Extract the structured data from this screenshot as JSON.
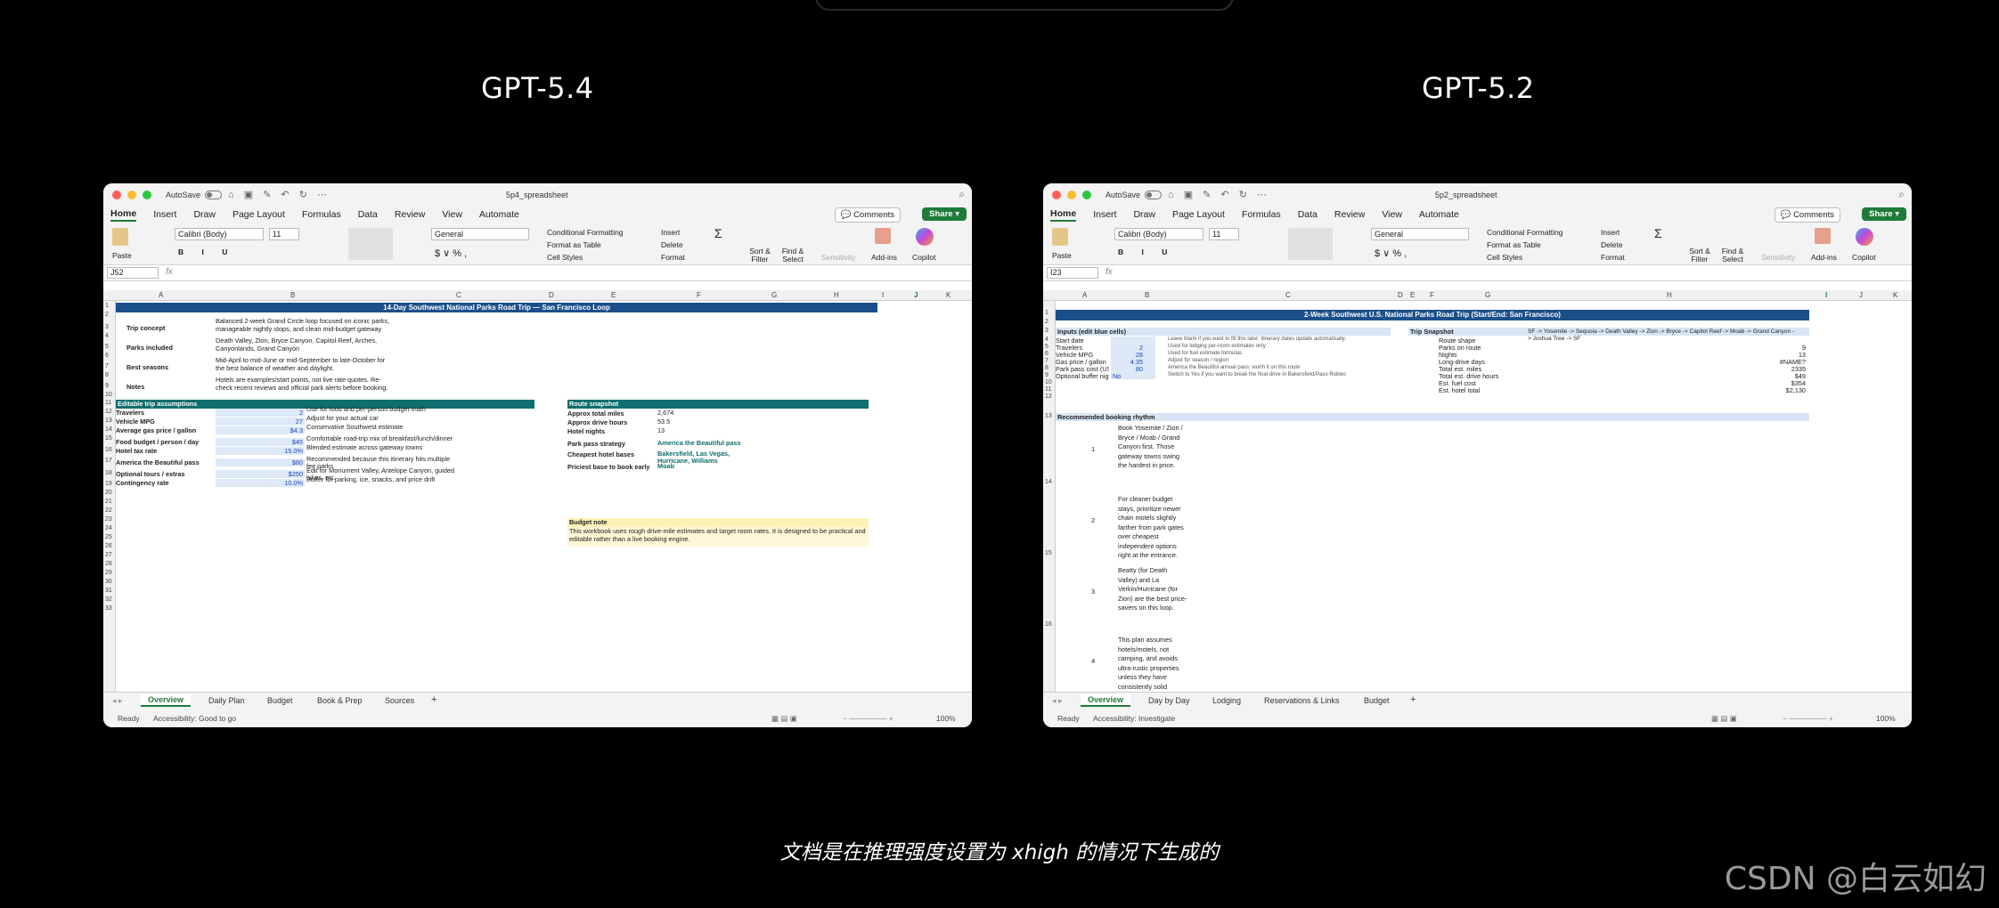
{
  "labels": {
    "left": "GPT-5.4",
    "right": "GPT-5.2",
    "caption": "文档是在推理强度设置为 xhigh 的情况下生成的",
    "watermark": "CSDN @白云如幻"
  },
  "common": {
    "autosave": "AutoSave",
    "menu": [
      "Home",
      "Insert",
      "Draw",
      "Page Layout",
      "Formulas",
      "Data",
      "Review",
      "View",
      "Automate"
    ],
    "comments": "Comments",
    "share": "Share",
    "font": "Calibri (Body)",
    "size": "11",
    "number_format": "General",
    "cond_fmt": "Conditional Formatting",
    "fmt_table": "Format as Table",
    "cell_styles": "Cell Styles",
    "insert": "Insert",
    "delete": "Delete",
    "format": "Format",
    "sort": "Sort & Filter",
    "find": "Find & Select",
    "sensitivity": "Sensitivity",
    "addins": "Add-ins",
    "copilot": "Copilot",
    "paste": "Paste",
    "fx": "fx",
    "ready": "Ready",
    "zoom": "100%"
  },
  "left": {
    "filename": "5p4_spreadsheet",
    "namebox": "J52",
    "title": "14-Day Southwest National Parks Road Trip — San Francisco Loop",
    "cols": [
      "A",
      "B",
      "C",
      "D",
      "E",
      "F",
      "G",
      "H",
      "I",
      "J",
      "K"
    ],
    "info": [
      {
        "k": "Trip concept",
        "v": "Balanced 2-week Grand Circle loop focused on iconic parks, manageable nightly stops, and clean mid-budget gateway"
      },
      {
        "k": "Parks included",
        "v": "Death Valley, Zion, Bryce Canyon, Capitol Reef, Arches, Canyonlands, Grand Canyon"
      },
      {
        "k": "Best seasons",
        "v": "Mid-April to mid-June or mid-September to late-October for the best balance of weather and daylight."
      },
      {
        "k": "Notes",
        "v": "Hotels are examples/start points, not live rate quotes. Re-check recent reviews and official park alerts before booking."
      }
    ],
    "assump_title": "Editable trip assumptions",
    "assump": [
      {
        "k": "Travelers",
        "v": "2",
        "n": "Use for food and per-person budget math"
      },
      {
        "k": "Vehicle MPG",
        "v": "27",
        "n": "Adjust for your actual car"
      },
      {
        "k": "Average gas price / gallon",
        "v": "$4.3",
        "n": "Conservative Southwest estimate"
      },
      {
        "k": "Food budget / person / day",
        "v": "$45",
        "n": "Comfortable road-trip mix of breakfast/lunch/dinner"
      },
      {
        "k": "Hotel tax rate",
        "v": "15.0%",
        "n": "Blended estimate across gateway towns"
      },
      {
        "k": "America the Beautiful pass",
        "v": "$80",
        "n": "Recommended because this itinerary hits multiple fee parks"
      },
      {
        "k": "Optional tours / extras",
        "v": "$250",
        "n": "Edit for Monument Valley, Antelope Canyon, guided hikes, etc."
      },
      {
        "k": "Contingency rate",
        "v": "10.0%",
        "n": "Buffer for parking, ice, snacks, and price drift"
      }
    ],
    "snap_title": "Route snapshot",
    "snap": [
      {
        "k": "Approx total miles",
        "v": "2,674"
      },
      {
        "k": "Approx drive hours",
        "v": "53.5"
      },
      {
        "k": "Hotel nights",
        "v": "13"
      },
      {
        "k": "Park pass strategy",
        "v": "America the Beautiful pass"
      },
      {
        "k": "Cheapest hotel bases",
        "v": "Bakersfield, Las Vegas, Hurricane, Williams"
      },
      {
        "k": "Priciest base to book early",
        "v": "Moab"
      }
    ],
    "note_title": "Budget note",
    "note": "This workbook uses rough drive-mile estimates and target room rates. It is designed to be practical and editable rather than a live booking engine.",
    "tabs": [
      "Overview",
      "Daily Plan",
      "Budget",
      "Book & Prep",
      "Sources"
    ],
    "access": "Accessibility: Good to go"
  },
  "right": {
    "filename": "5p2_spreadsheet",
    "namebox": "I23",
    "title": "2-Week Southwest U.S. National Parks Road Trip (Start/End: San Francisco)",
    "cols": [
      "A",
      "B",
      "C",
      "D",
      "E",
      "F",
      "G",
      "H",
      "I",
      "J",
      "K"
    ],
    "inputs_title": "Inputs (edit blue cells)",
    "inputs": [
      {
        "k": "Start date",
        "v": "",
        "n": "Leave blank if you want to fill this later; itinerary dates update automatically."
      },
      {
        "k": "Travelers",
        "v": "2",
        "n": "Used for lodging per-room estimates only"
      },
      {
        "k": "Vehicle MPG",
        "v": "28",
        "n": "Used for fuel estimate formulas"
      },
      {
        "k": "Gas price / gallon",
        "v": "4.35",
        "n": "Adjust for season / region"
      },
      {
        "k": "Park pass cost (US re",
        "v": "80",
        "n": "America the Beautiful annual pass; worth it on this route"
      },
      {
        "k": "Optional buffer night",
        "v": "No",
        "n": "Switch to Yes if you want to break the final drive in Bakersfield/Paso Robles"
      }
    ],
    "snap_title": "Trip Snapshot",
    "snap": [
      {
        "k": "Route shape",
        "v": "SF -> Yosemite -> Sequoia -> Death Valley -> Zion -> Bryce -> Capitol Reef -> Moab -> Grand Canyon -> Joshua Tree -> SF"
      },
      {
        "k": "Parks on route",
        "v": "9"
      },
      {
        "k": "Nights",
        "v": "13"
      },
      {
        "k": "Long-drive days",
        "v": "#NAME?"
      },
      {
        "k": "Total est. miles",
        "v": "2335"
      },
      {
        "k": "Total est. drive hours",
        "v": "$49"
      },
      {
        "k": "Est. fuel cost",
        "v": "$354"
      },
      {
        "k": "Est. hotel total",
        "v": "$2,130"
      }
    ],
    "rhythm_title": "Recommended booking rhythm",
    "rhythm": [
      {
        "n": "1",
        "t": "Book Yosemite / Zion / Bryce / Moab / Grand Canyon first. Those gateway towns swing the hardest in price."
      },
      {
        "n": "2",
        "t": "For cleaner budget stays, prioritize newer chain motels slightly farther from park gates over cheapest independent options right at the entrance."
      },
      {
        "n": "3",
        "t": "Beatty (for Death Valley) and La Verkin/Hurricane (for Zion) are the best price-savers on this loop."
      },
      {
        "n": "4",
        "t": "This plan assumes hotels/motels, not camping, and avoids ultra-rustic properties unless they have consistently solid reputations."
      }
    ],
    "tabs": [
      "Overview",
      "Day by Day",
      "Lodging",
      "Reservations & Links",
      "Budget"
    ],
    "access": "Accessibility: Investigate"
  }
}
